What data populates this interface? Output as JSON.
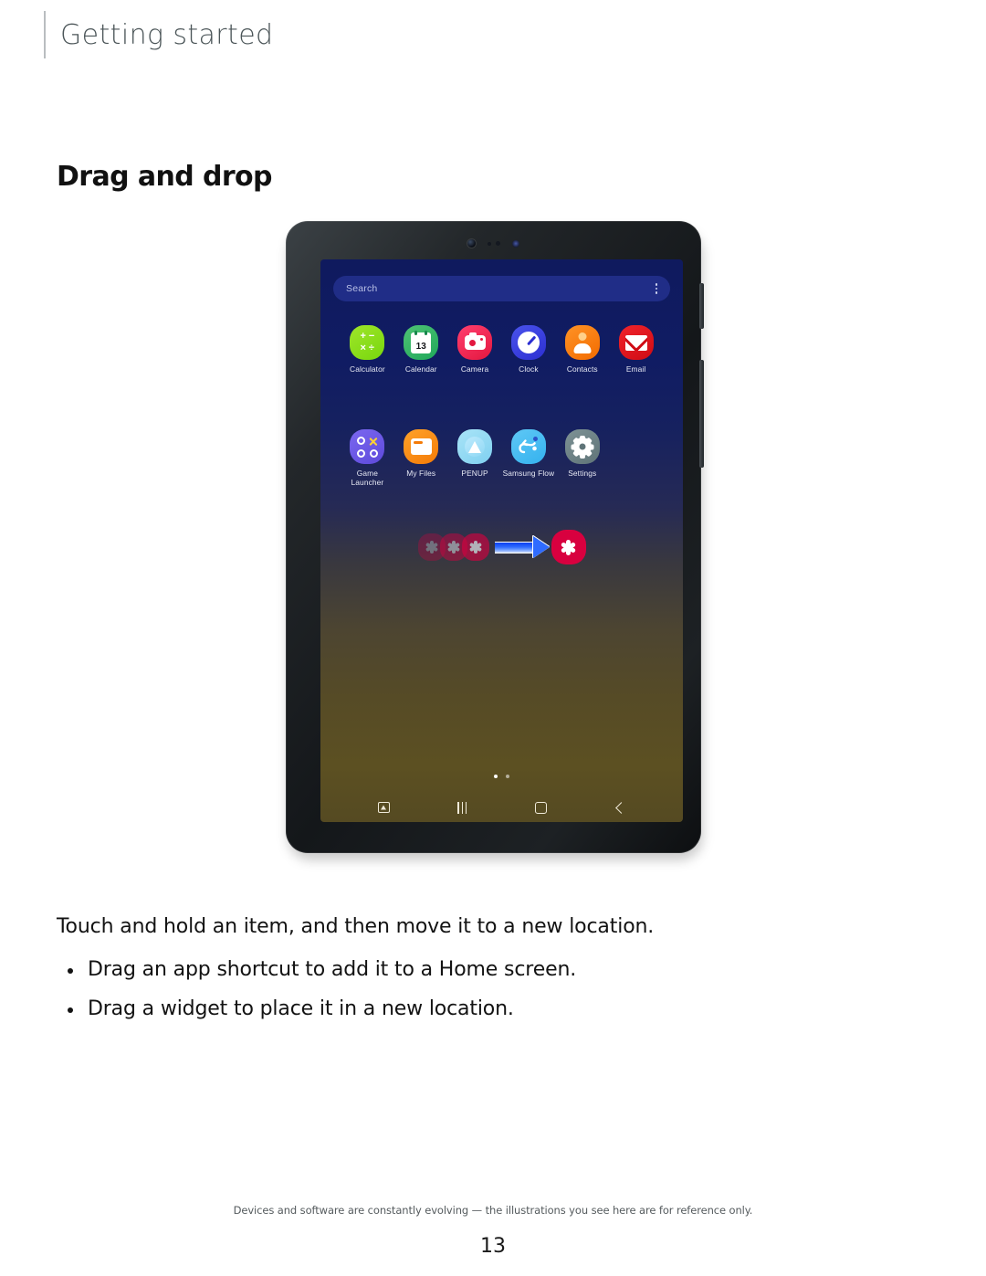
{
  "document": {
    "running_header": "Getting started",
    "section_title": "Drag and drop",
    "body_lede": "Touch and hold an item, and then move it to a new location.",
    "bullets": [
      "Drag an app shortcut to add it to a Home screen.",
      "Drag a widget to place it in a new location."
    ],
    "footer_note": "Devices and software are constantly evolving — the illustrations you see here are for reference only.",
    "page_number": "13"
  },
  "figure": {
    "device": "samsung-galaxy-tab",
    "screen": {
      "search": {
        "placeholder": "Search",
        "more_icon": "three-dot-menu-icon"
      },
      "app_rows": [
        [
          {
            "label": "Calculator",
            "icon": "calculator-icon",
            "color": "#8ade1b"
          },
          {
            "label": "Calendar",
            "icon": "calendar-icon",
            "color": "#27a95e",
            "badge": "13"
          },
          {
            "label": "Camera",
            "icon": "camera-icon",
            "color": "#ea2352"
          },
          {
            "label": "Clock",
            "icon": "clock-icon",
            "color": "#3239dd"
          },
          {
            "label": "Contacts",
            "icon": "contacts-icon",
            "color": "#f77e10"
          },
          {
            "label": "Email",
            "icon": "email-icon",
            "color": "#dd1219"
          }
        ],
        [
          {
            "label": "Game Launcher",
            "icon": "game-launcher-icon",
            "color": "#6a56e6"
          },
          {
            "label": "My Files",
            "icon": "my-files-icon",
            "color": "#f98c14"
          },
          {
            "label": "PENUP",
            "icon": "penup-icon",
            "color": "#8bd6f2"
          },
          {
            "label": "Samsung Flow",
            "icon": "samsung-flow-icon",
            "color": "#42b8f1"
          },
          {
            "label": "Settings",
            "icon": "settings-gear-icon",
            "color": "#697d81"
          }
        ]
      ],
      "drag_demo": {
        "dragged_icon": "flower-app-icon",
        "dragged_icon_color": "#d8003f",
        "ghost_count": 3,
        "arrow_icon": "right-arrow-icon",
        "arrow_color": "#2f6bff"
      },
      "home_page_dots": 2,
      "nav_bar": [
        {
          "icon": "screenshot-capture-icon"
        },
        {
          "icon": "recents-icon"
        },
        {
          "icon": "home-icon"
        },
        {
          "icon": "back-icon"
        }
      ]
    },
    "hardware": {
      "front_camera": "front-camera-lens",
      "sensors": "proximity-sensor-dots",
      "indicator_led": "indicator-led",
      "side_buttons": [
        "power-button",
        "volume-button"
      ]
    }
  }
}
